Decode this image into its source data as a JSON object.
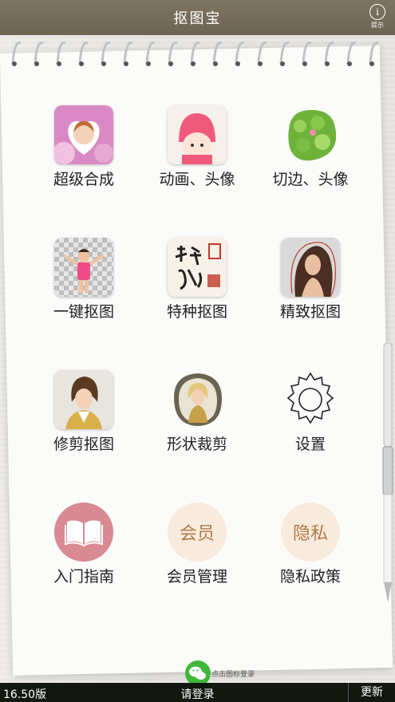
{
  "header": {
    "title": "抠图宝",
    "info_label": "提示"
  },
  "tiles": [
    {
      "label": "超级合成"
    },
    {
      "label": "动画、头像"
    },
    {
      "label": "切边、头像"
    },
    {
      "label": "一键抠图"
    },
    {
      "label": "特种抠图"
    },
    {
      "label": "精致抠图"
    },
    {
      "label": "修剪抠图"
    },
    {
      "label": "形状裁剪"
    },
    {
      "label": "设置"
    },
    {
      "label": "入门指南"
    },
    {
      "label": "会员管理",
      "badge": "会员"
    },
    {
      "label": "隐私政策",
      "badge": "隐私"
    }
  ],
  "wechat": {
    "hint": "点击图标登录"
  },
  "footer": {
    "version": "16.50版",
    "login": "请登录",
    "update": "更新"
  },
  "colors": {
    "topbar": "#756d59",
    "bottombar": "#12180f",
    "guide_circle": "#d98a91",
    "badge_text": "#b07a48"
  }
}
